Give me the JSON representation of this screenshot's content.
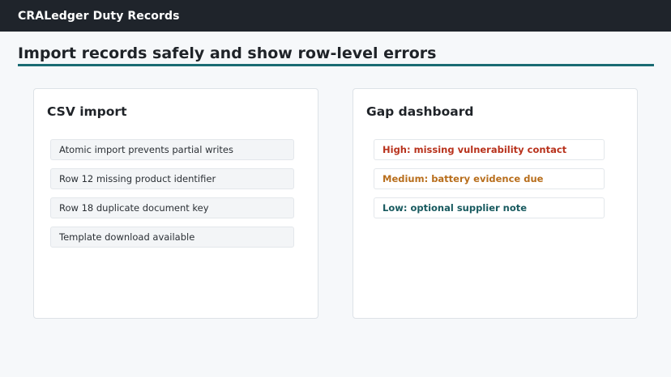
{
  "app": {
    "title": "CRALedger Duty Records"
  },
  "page": {
    "title": "Import records safely and show row-level errors"
  },
  "csv_import": {
    "title": "CSV import",
    "items": [
      "Atomic import prevents partial writes",
      "Row 12 missing product identifier",
      "Row 18 duplicate document key",
      "Template download available"
    ]
  },
  "gap_dashboard": {
    "title": "Gap dashboard",
    "items": [
      {
        "label": "High: missing vulnerability contact",
        "color": "#b8321c"
      },
      {
        "label": "Medium: battery evidence due",
        "color": "#b86e1c"
      },
      {
        "label": "Low: optional supplier note",
        "color": "#185a5f"
      }
    ]
  },
  "colors": {
    "topbar": "#1f242b",
    "accent": "#1a6b73"
  }
}
